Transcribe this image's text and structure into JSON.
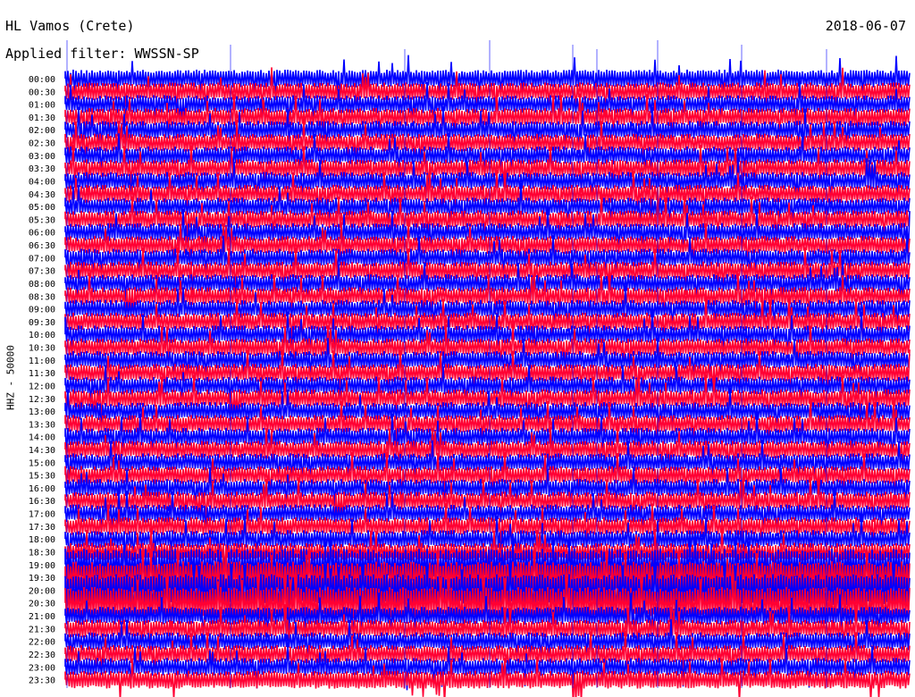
{
  "header": {
    "station": "HL Vamos (Crete)",
    "date": "2018-06-07",
    "filter": "Applied filter: WWSSN-SP"
  },
  "chart_data": {
    "type": "line",
    "title": "HL Vamos (Crete)",
    "subtitle": "Applied filter: WWSSN-SP",
    "date": "2018-06-07",
    "ylabel": "HHZ - 50000",
    "row_labels": [
      "00:00",
      "00:30",
      "01:00",
      "01:30",
      "02:00",
      "02:30",
      "03:00",
      "03:30",
      "04:00",
      "04:30",
      "05:00",
      "05:30",
      "06:00",
      "06:30",
      "07:00",
      "07:30",
      "08:00",
      "08:30",
      "09:00",
      "09:30",
      "10:00",
      "10:30",
      "11:00",
      "11:30",
      "12:00",
      "12:30",
      "13:00",
      "13:30",
      "14:00",
      "14:30",
      "15:00",
      "15:30",
      "16:00",
      "16:30",
      "17:00",
      "17:30",
      "18:00",
      "18:30",
      "19:00",
      "19:30",
      "20:00",
      "20:30",
      "21:00",
      "21:30",
      "22:00",
      "22:30",
      "23:00",
      "23:30"
    ],
    "trace_colors": [
      "#0000ff",
      "#ff0033"
    ],
    "rows_per_hour": 2,
    "minutes_per_row": 30,
    "grid": false
  }
}
